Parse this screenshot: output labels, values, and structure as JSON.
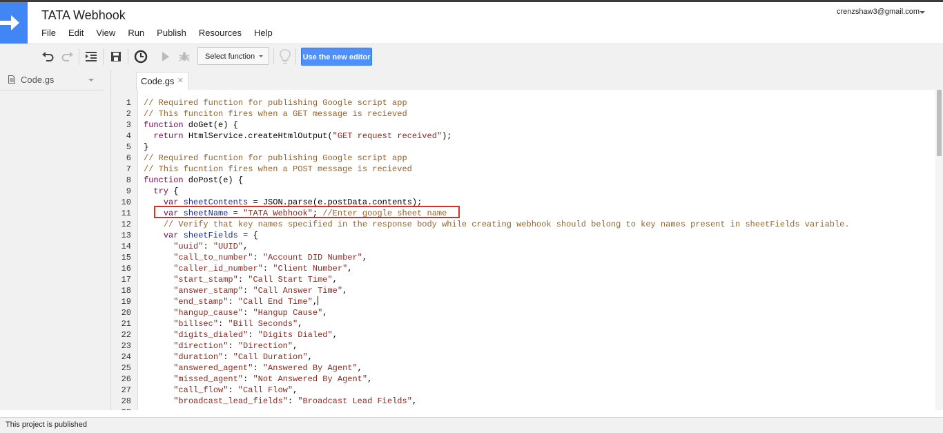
{
  "app": {
    "title": "TATA Webhook",
    "account": "crenzshaw3@gmail.com",
    "brand_color": "#4285f4"
  },
  "menu": [
    "File",
    "Edit",
    "View",
    "Run",
    "Publish",
    "Resources",
    "Help"
  ],
  "toolbar": {
    "select_function_label": "Select function",
    "new_editor_label": "Use the new editor",
    "new_editor_color": "#4d90fe",
    "icons": [
      "undo-icon",
      "redo-icon",
      "indent-icon",
      "save-icon",
      "triggers-clock-icon",
      "run-icon",
      "debug-icon",
      "lightbulb-icon"
    ]
  },
  "sidebar": {
    "files": [
      {
        "name": "Code.gs",
        "icon": "document-icon"
      }
    ]
  },
  "editor": {
    "tab_label": "Code.gs",
    "highlighted_line": 11,
    "highlight_color": "#d93025",
    "lines": [
      [
        {
          "t": "// Required function for publishing Google script app",
          "c": "cm"
        }
      ],
      [
        {
          "t": "// This funciton fires when a GET message is recieved",
          "c": "cm"
        }
      ],
      [
        {
          "t": "function",
          "c": "kw"
        },
        {
          "t": " doGet(e) {",
          "c": ""
        }
      ],
      [
        {
          "t": "  ",
          "c": ""
        },
        {
          "t": "return",
          "c": "kw"
        },
        {
          "t": " HtmlService.createHtmlOutput(",
          "c": ""
        },
        {
          "t": "\"GET request received\"",
          "c": "st"
        },
        {
          "t": ");",
          "c": ""
        }
      ],
      [
        {
          "t": "}",
          "c": ""
        }
      ],
      [
        {
          "t": "// Required fucntion for publishing Google script app",
          "c": "cm"
        }
      ],
      [
        {
          "t": "// This fucntion fires when a POST message is recieved",
          "c": "cm"
        }
      ],
      [
        {
          "t": "function",
          "c": "kw"
        },
        {
          "t": " doPost(e) {",
          "c": ""
        }
      ],
      [
        {
          "t": "  ",
          "c": ""
        },
        {
          "t": "try",
          "c": "kw"
        },
        {
          "t": " {",
          "c": ""
        }
      ],
      [
        {
          "t": "    ",
          "c": ""
        },
        {
          "t": "var",
          "c": "kw"
        },
        {
          "t": " ",
          "c": ""
        },
        {
          "t": "sheetContents",
          "c": "vr"
        },
        {
          "t": " = JSON.parse(e.postData.contents);",
          "c": ""
        }
      ],
      [
        {
          "t": "    ",
          "c": ""
        },
        {
          "t": "var",
          "c": "kw"
        },
        {
          "t": " ",
          "c": ""
        },
        {
          "t": "sheetName",
          "c": "vr"
        },
        {
          "t": " = ",
          "c": ""
        },
        {
          "t": "\"TATA Webhook\"",
          "c": "st"
        },
        {
          "t": "; ",
          "c": ""
        },
        {
          "t": "//Enter google sheet name",
          "c": "cm"
        }
      ],
      [
        {
          "t": "    ",
          "c": ""
        },
        {
          "t": "// Verify that key names specified in the response body while creating webhook should belong to key names present in sheetFields variable.",
          "c": "cm"
        }
      ],
      [
        {
          "t": "    ",
          "c": ""
        },
        {
          "t": "var",
          "c": "kw"
        },
        {
          "t": " ",
          "c": ""
        },
        {
          "t": "sheetFields",
          "c": "vr"
        },
        {
          "t": " = {",
          "c": ""
        }
      ],
      [
        {
          "t": "      ",
          "c": ""
        },
        {
          "t": "\"uuid\"",
          "c": "st"
        },
        {
          "t": ": ",
          "c": ""
        },
        {
          "t": "\"UUID\"",
          "c": "st"
        },
        {
          "t": ",",
          "c": ""
        }
      ],
      [
        {
          "t": "      ",
          "c": ""
        },
        {
          "t": "\"call_to_number\"",
          "c": "st"
        },
        {
          "t": ": ",
          "c": ""
        },
        {
          "t": "\"Account DID Number\"",
          "c": "st"
        },
        {
          "t": ",",
          "c": ""
        }
      ],
      [
        {
          "t": "      ",
          "c": ""
        },
        {
          "t": "\"caller_id_number\"",
          "c": "st"
        },
        {
          "t": ": ",
          "c": ""
        },
        {
          "t": "\"Client Number\"",
          "c": "st"
        },
        {
          "t": ",",
          "c": ""
        }
      ],
      [
        {
          "t": "      ",
          "c": ""
        },
        {
          "t": "\"start_stamp\"",
          "c": "st"
        },
        {
          "t": ": ",
          "c": ""
        },
        {
          "t": "\"Call Start Time\"",
          "c": "st"
        },
        {
          "t": ",",
          "c": ""
        }
      ],
      [
        {
          "t": "      ",
          "c": ""
        },
        {
          "t": "\"answer_stamp\"",
          "c": "st"
        },
        {
          "t": ": ",
          "c": ""
        },
        {
          "t": "\"Call Answer Time\"",
          "c": "st"
        },
        {
          "t": ",",
          "c": ""
        }
      ],
      [
        {
          "t": "      ",
          "c": ""
        },
        {
          "t": "\"end_stamp\"",
          "c": "st"
        },
        {
          "t": ": ",
          "c": ""
        },
        {
          "t": "\"Call End Time\"",
          "c": "st"
        },
        {
          "t": ",",
          "c": ""
        },
        {
          "t": "",
          "c": "cursor"
        }
      ],
      [
        {
          "t": "      ",
          "c": ""
        },
        {
          "t": "\"hangup_cause\"",
          "c": "st"
        },
        {
          "t": ": ",
          "c": ""
        },
        {
          "t": "\"Hangup Cause\"",
          "c": "st"
        },
        {
          "t": ",",
          "c": ""
        }
      ],
      [
        {
          "t": "      ",
          "c": ""
        },
        {
          "t": "\"billsec\"",
          "c": "st"
        },
        {
          "t": ": ",
          "c": ""
        },
        {
          "t": "\"Bill Seconds\"",
          "c": "st"
        },
        {
          "t": ",",
          "c": ""
        }
      ],
      [
        {
          "t": "      ",
          "c": ""
        },
        {
          "t": "\"digits_dialed\"",
          "c": "st"
        },
        {
          "t": ": ",
          "c": ""
        },
        {
          "t": "\"Digits Dialed\"",
          "c": "st"
        },
        {
          "t": ",",
          "c": ""
        }
      ],
      [
        {
          "t": "      ",
          "c": ""
        },
        {
          "t": "\"direction\"",
          "c": "st"
        },
        {
          "t": ": ",
          "c": ""
        },
        {
          "t": "\"Direction\"",
          "c": "st"
        },
        {
          "t": ",",
          "c": ""
        }
      ],
      [
        {
          "t": "      ",
          "c": ""
        },
        {
          "t": "\"duration\"",
          "c": "st"
        },
        {
          "t": ": ",
          "c": ""
        },
        {
          "t": "\"Call Duration\"",
          "c": "st"
        },
        {
          "t": ",",
          "c": ""
        }
      ],
      [
        {
          "t": "      ",
          "c": ""
        },
        {
          "t": "\"answered_agent\"",
          "c": "st"
        },
        {
          "t": ": ",
          "c": ""
        },
        {
          "t": "\"Answered By Agent\"",
          "c": "st"
        },
        {
          "t": ",",
          "c": ""
        }
      ],
      [
        {
          "t": "      ",
          "c": ""
        },
        {
          "t": "\"missed_agent\"",
          "c": "st"
        },
        {
          "t": ": ",
          "c": ""
        },
        {
          "t": "\"Not Answered By Agent\"",
          "c": "st"
        },
        {
          "t": ",",
          "c": ""
        }
      ],
      [
        {
          "t": "      ",
          "c": ""
        },
        {
          "t": "\"call_flow\"",
          "c": "st"
        },
        {
          "t": ": ",
          "c": ""
        },
        {
          "t": "\"Call Flow\"",
          "c": "st"
        },
        {
          "t": ",",
          "c": ""
        }
      ],
      [
        {
          "t": "      ",
          "c": ""
        },
        {
          "t": "\"broadcast_lead_fields\"",
          "c": "st"
        },
        {
          "t": ": ",
          "c": ""
        },
        {
          "t": "\"Broadcast Lead Fields\"",
          "c": "st"
        },
        {
          "t": ",",
          "c": ""
        }
      ]
    ]
  },
  "status": {
    "text": "This project is published"
  }
}
